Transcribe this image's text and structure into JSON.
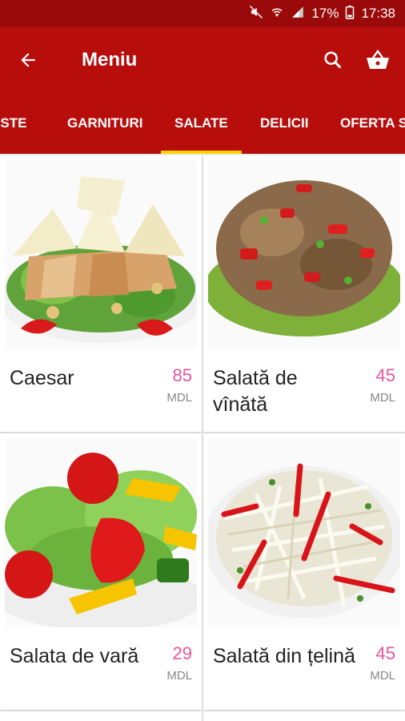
{
  "status": {
    "battery": "17%",
    "time": "17:38"
  },
  "header": {
    "title": "Meniu"
  },
  "tabs": [
    {
      "label": "PASTE"
    },
    {
      "label": "GARNITURI"
    },
    {
      "label": "SALATE"
    },
    {
      "label": "DELICII"
    },
    {
      "label": "OFERTA SPECIALA"
    }
  ],
  "active_tab": "SALATE",
  "products": [
    {
      "name": "Caesar",
      "price": "85",
      "currency": "MDL"
    },
    {
      "name": "Salată de vînătă",
      "price": "45",
      "currency": "MDL"
    },
    {
      "name": "Salata de vară",
      "price": "29",
      "currency": "MDL"
    },
    {
      "name": "Salată din țelină",
      "price": "45",
      "currency": "MDL"
    }
  ],
  "colors": {
    "primary": "#b70d0b",
    "statusbar": "#9b0a0a",
    "indicator": "#ffd400",
    "price": "#e8549a"
  }
}
